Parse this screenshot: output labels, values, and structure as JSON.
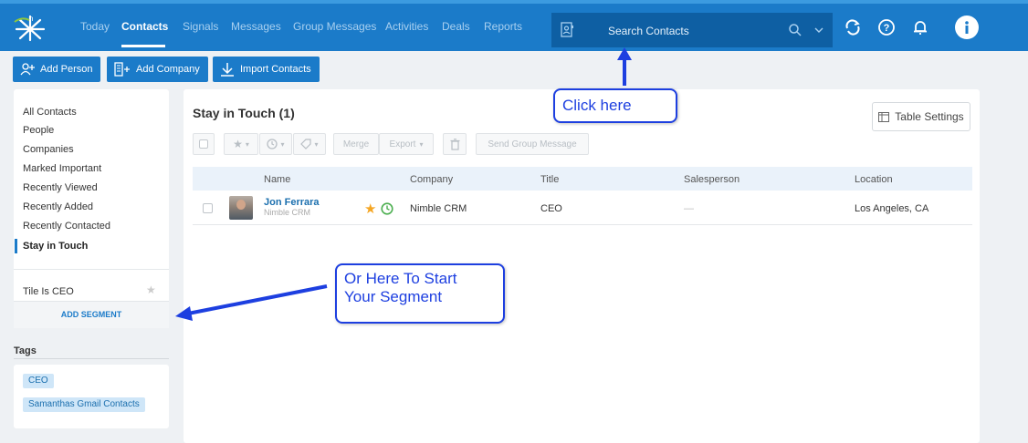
{
  "nav": {
    "items": [
      {
        "label": "Today",
        "active": false
      },
      {
        "label": "Contacts",
        "active": true
      },
      {
        "label": "Signals",
        "active": false
      },
      {
        "label": "Messages",
        "active": false
      },
      {
        "label": "Group Messages",
        "active": false
      },
      {
        "label": "Activities",
        "active": false
      },
      {
        "label": "Deals",
        "active": false
      },
      {
        "label": "Reports",
        "active": false
      }
    ],
    "search_placeholder": "Search Contacts"
  },
  "actions": {
    "add_person": "Add Person",
    "add_company": "Add Company",
    "import_contacts": "Import Contacts"
  },
  "sidebar": {
    "items": [
      {
        "label": "All Contacts",
        "active": false
      },
      {
        "label": "People",
        "active": false
      },
      {
        "label": "Companies",
        "active": false
      },
      {
        "label": "Marked Important",
        "active": false
      },
      {
        "label": "Recently Viewed",
        "active": false
      },
      {
        "label": "Recently Added",
        "active": false
      },
      {
        "label": "Recently Contacted",
        "active": false
      },
      {
        "label": "Stay in Touch",
        "active": true
      }
    ],
    "segment": "Tile Is CEO",
    "add_segment": "ADD SEGMENT"
  },
  "tags": {
    "heading": "Tags",
    "items": [
      "CEO",
      "Samanthas Gmail Contacts"
    ]
  },
  "main": {
    "title": "Stay in Touch (1)",
    "table_settings": "Table Settings",
    "toolbar": {
      "merge": "Merge",
      "export": "Export",
      "send_group_message": "Send Group Message"
    },
    "columns": [
      "Name",
      "Company",
      "Title",
      "Salesperson",
      "Location"
    ],
    "rows": [
      {
        "name": "Jon Ferrara",
        "sub": "Nimble CRM",
        "company": "Nimble CRM",
        "title": "CEO",
        "salesperson": "—",
        "location": "Los Angeles, CA"
      }
    ]
  },
  "annotations": {
    "click_here": "Click here",
    "segment_line1": "Or Here To Start",
    "segment_line2": "Your Segment"
  },
  "colors": {
    "brand_blue": "#1b7bc9",
    "annotation_blue": "#1d3fe0",
    "star": "#f5a623",
    "clock": "#4caf50"
  }
}
